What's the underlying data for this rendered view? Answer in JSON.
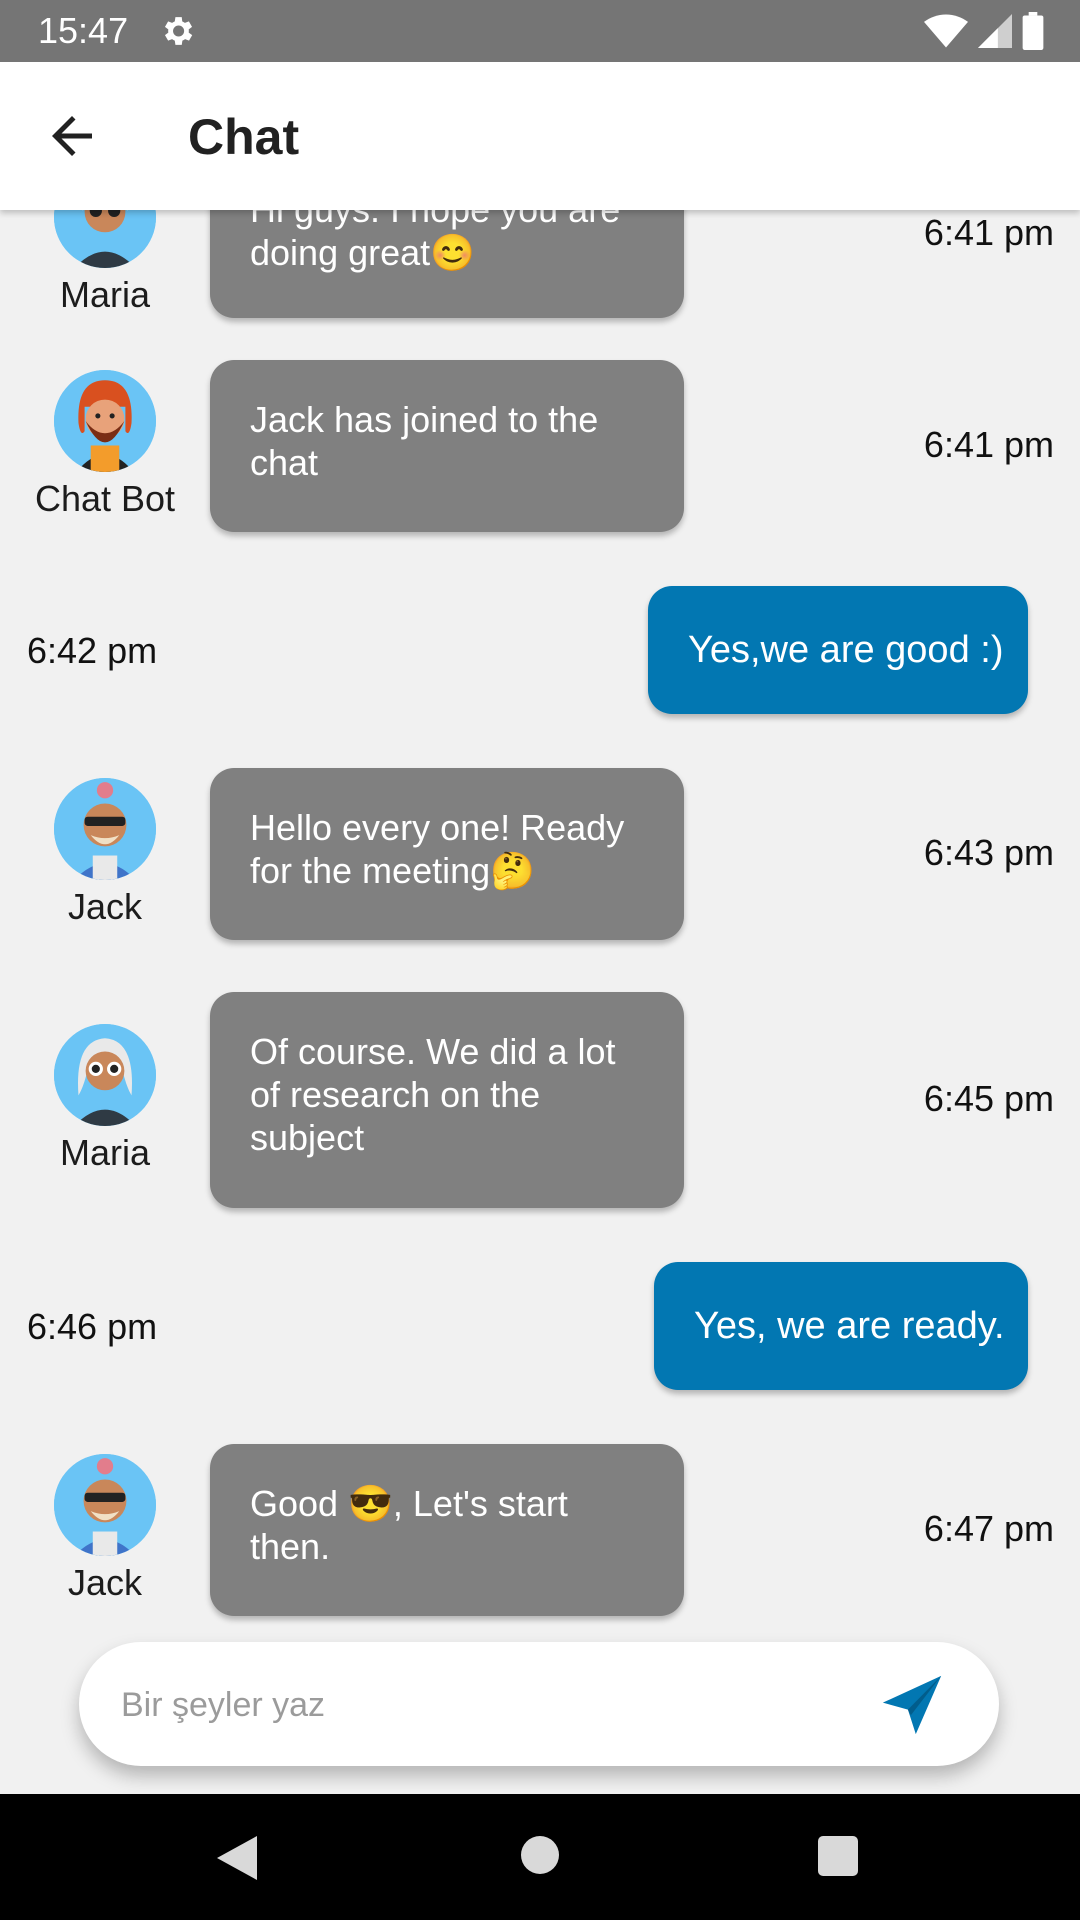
{
  "status_bar": {
    "time": "15:47",
    "icons": [
      "gear-icon",
      "wifi-icon",
      "signal-icon",
      "battery-icon"
    ]
  },
  "app_bar": {
    "back_icon": "arrow-left-icon",
    "title": "Chat"
  },
  "messages": [
    {
      "type": "incoming",
      "sender": "Maria",
      "text": "Hi guys. I hope you are doing great😊",
      "time": "6:41 pm"
    },
    {
      "type": "incoming",
      "sender": "Chat Bot",
      "text": "Jack has joined to the chat",
      "time": "6:41 pm"
    },
    {
      "type": "outgoing",
      "text": "Yes,we are good :)",
      "time": "6:42 pm"
    },
    {
      "type": "incoming",
      "sender": "Jack",
      "text": "Hello every one! Ready for the meeting🤔",
      "time": "6:43 pm"
    },
    {
      "type": "incoming",
      "sender": "Maria",
      "text": "Of course. We did a lot of research on the subject",
      "time": "6:45 pm"
    },
    {
      "type": "outgoing",
      "text": "Yes, we are ready.",
      "time": "6:46 pm"
    },
    {
      "type": "incoming",
      "sender": "Jack",
      "text": "Good 😎, Let's start then.",
      "time": "6:47 pm"
    }
  ],
  "composer": {
    "placeholder": "Bir şeyler yaz",
    "value": "",
    "send_icon": "send-icon"
  },
  "colors": {
    "incoming_bubble": "#808080",
    "outgoing_bubble": "#0277b2",
    "background": "#f1f1f1",
    "status_bar": "#757575"
  }
}
